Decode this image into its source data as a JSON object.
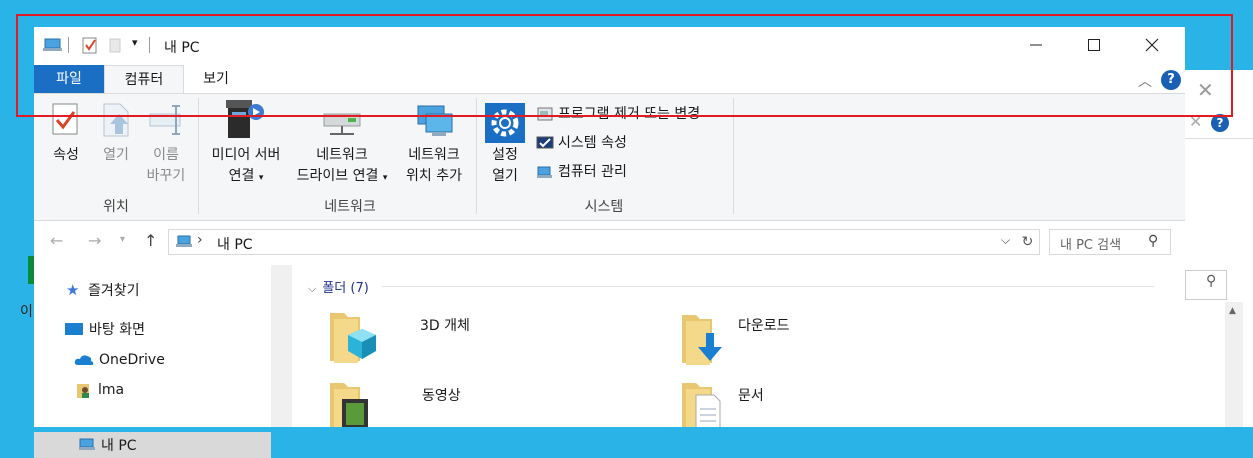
{
  "window": {
    "title": "내 PC"
  },
  "tabs": [
    {
      "label": "파일"
    },
    {
      "label": "컴퓨터"
    },
    {
      "label": "보기"
    }
  ],
  "ribbon": {
    "location": {
      "group_label": "위치",
      "properties": "속성",
      "open": "열기",
      "rename_line1": "이름",
      "rename_line2": "바꾸기"
    },
    "network": {
      "group_label": "네트워크",
      "media_line1": "미디어 서버",
      "media_line2": "연결",
      "map_line1": "네트워크",
      "map_line2": "드라이브 연결",
      "add_line1": "네트워크",
      "add_line2": "위치 추가"
    },
    "system": {
      "group_label": "시스템",
      "settings_line1": "설정",
      "settings_line2": "열기",
      "uninstall": "프로그램 제거 또는 변경",
      "properties": "시스템 속성",
      "manage": "컴퓨터 관리"
    }
  },
  "address": {
    "path": "내 PC",
    "search_placeholder": "내 PC 검색"
  },
  "nav": {
    "items": [
      {
        "label": "즐겨찾기"
      },
      {
        "label": "바탕 화면"
      },
      {
        "label": "OneDrive"
      },
      {
        "label": "lma"
      },
      {
        "label": "내 PC"
      }
    ]
  },
  "content": {
    "section": "폴더 (7)",
    "folders": [
      {
        "label": "3D 개체"
      },
      {
        "label": "다운로드"
      },
      {
        "label": "동영상"
      },
      {
        "label": "문서"
      }
    ]
  },
  "background": {
    "left_text": "이"
  },
  "colors": {
    "accent": "#1a6fc5",
    "desktop": "#29b3e6",
    "highlight_box": "#e01b24"
  }
}
